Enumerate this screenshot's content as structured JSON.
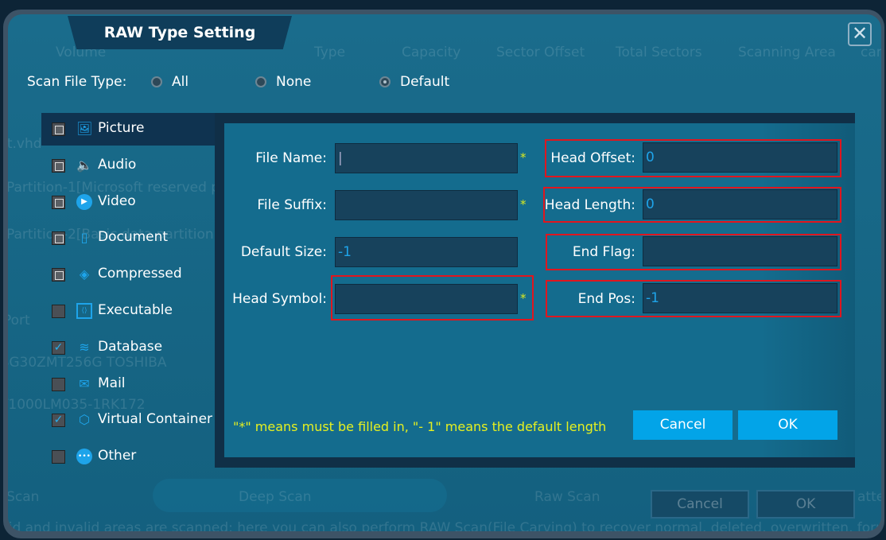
{
  "dialog": {
    "title": "RAW Type Setting",
    "close_icon": "close-icon"
  },
  "background": {
    "headers": [
      "Volume",
      "Type",
      "Capacity",
      "Sector Offset",
      "Total Sectors",
      "Scanning Area",
      "can"
    ],
    "rows": [
      "st.vhd",
      "Partition-1[Microsoft reserved p",
      "Partition-2[Basic data partition]",
      "Port",
      "BG30ZMT256G TOSHIBA",
      "T1000LM035-1RK172"
    ],
    "scan_modes": [
      "t Scan",
      "Deep Scan",
      "Raw Scan",
      "atter"
    ],
    "cancel": "Cancel",
    "ok": "OK",
    "footer": "lid and invalid areas are scanned; here you can also perform RAW Scan(File Carving) to recover normal, deleted, overwritten, formatt"
  },
  "scan_type": {
    "label": "Scan File Type:",
    "options": [
      {
        "label": "All",
        "selected": false
      },
      {
        "label": "None",
        "selected": false
      },
      {
        "label": "Default",
        "selected": true
      }
    ]
  },
  "categories": [
    {
      "label": "Picture",
      "state": "partial",
      "icon": "image-icon",
      "selected": true
    },
    {
      "label": "Audio",
      "state": "partial",
      "icon": "speaker-icon"
    },
    {
      "label": "Video",
      "state": "partial",
      "icon": "play-icon"
    },
    {
      "label": "Document",
      "state": "partial",
      "icon": "document-icon"
    },
    {
      "label": "Compressed",
      "state": "partial",
      "icon": "layers-icon"
    },
    {
      "label": "Executable",
      "state": "unchecked",
      "icon": "code-icon"
    },
    {
      "label": "Database",
      "state": "checked",
      "icon": "database-icon"
    },
    {
      "label": "Mail",
      "state": "unchecked",
      "icon": "mail-icon"
    },
    {
      "label": "Virtual Container",
      "state": "checked",
      "icon": "container-icon"
    },
    {
      "label": "Other",
      "state": "unchecked",
      "icon": "more-icon"
    }
  ],
  "form": {
    "file_name": {
      "label": "File Name:",
      "value": "|"
    },
    "file_suffix": {
      "label": "File Suffix:",
      "value": ""
    },
    "default_size": {
      "label": "Default Size:",
      "value": "-1"
    },
    "head_symbol": {
      "label": "Head Symbol:",
      "value": ""
    },
    "head_offset": {
      "label": "Head Offset:",
      "value": "0"
    },
    "head_length": {
      "label": "Head Length:",
      "value": "0"
    },
    "end_flag": {
      "label": "End Flag:",
      "value": ""
    },
    "end_pos": {
      "label": "End Pos:",
      "value": "-1"
    },
    "required_mark": "*",
    "note": "\"*\" means must be filled in, \"- 1\" means the default length",
    "cancel": "Cancel",
    "ok": "OK"
  },
  "colors": {
    "accent": "#02a4e8",
    "highlight": "#e0161e",
    "note": "#e6f020"
  }
}
